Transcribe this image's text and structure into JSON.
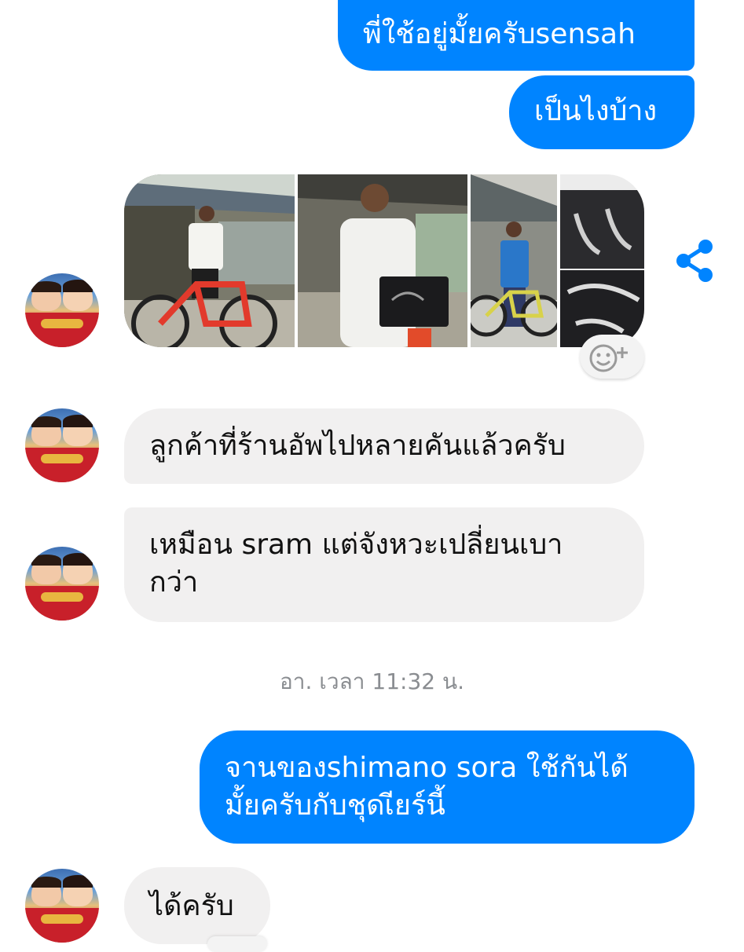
{
  "messages": {
    "m1": "พี่ใช้อยู่มั้ยครับsensah",
    "m2": "เป็นไงบ้าง",
    "m3": "ลูกค้าที่ร้านอัพไปหลายคันแล้วครับ",
    "m4_line1": "เหมือน sram แต่จังหวะเปลี่ยนเบา",
    "m4_line2": "กว่า",
    "m5_line1": "จานของshimano sora ใช้กันได้",
    "m5_line2": "มั้ยครับกับชุดเียร์นี้",
    "m6": "ได้ครับ"
  },
  "timestamp": "อา. เวลา 11:32 น.",
  "colors": {
    "outgoing_bubble": "#0084ff",
    "incoming_bubble": "#f1f0f0",
    "share_icon": "#0084ff"
  },
  "icons": [
    "share-icon",
    "add-reaction-icon"
  ]
}
